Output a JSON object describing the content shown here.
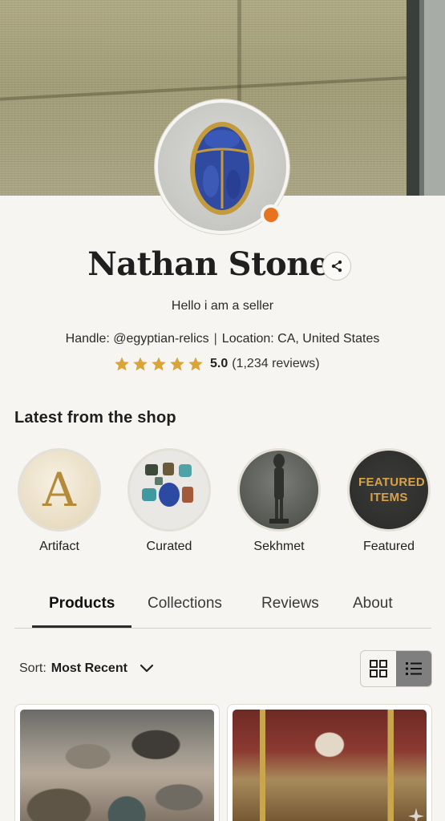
{
  "profile": {
    "name": "Nathan Stone",
    "tagline": "Hello i am a seller",
    "handle_label": "Handle: @egyptian-relics",
    "location_label": "Location: CA, United States",
    "separator": "|",
    "rating_score": "5.0",
    "rating_count": "(1,234 reviews)",
    "rating_stars": 5,
    "status_color": "#e8731f"
  },
  "shop": {
    "section_title": "Latest from the shop",
    "collections": [
      {
        "label": "Artifact",
        "thumb_text": "A"
      },
      {
        "label": "Curated"
      },
      {
        "label": "Sekhmet"
      },
      {
        "label": "Featured",
        "thumb_text": "FEATURED ITEMS"
      }
    ]
  },
  "tabs": [
    {
      "label": "Products",
      "active": true
    },
    {
      "label": "Collections"
    },
    {
      "label": "Reviews"
    },
    {
      "label": "About"
    }
  ],
  "sort": {
    "label": "Sort:",
    "value": "Most Recent"
  },
  "view_mode": "list",
  "icons": {
    "share": "share-icon",
    "star": "star-icon",
    "chevron": "chevron-down-icon",
    "grid": "grid-view-icon",
    "list": "list-view-icon"
  },
  "colors": {
    "accent_star": "#d9a53a",
    "status_dot": "#e8731f"
  }
}
